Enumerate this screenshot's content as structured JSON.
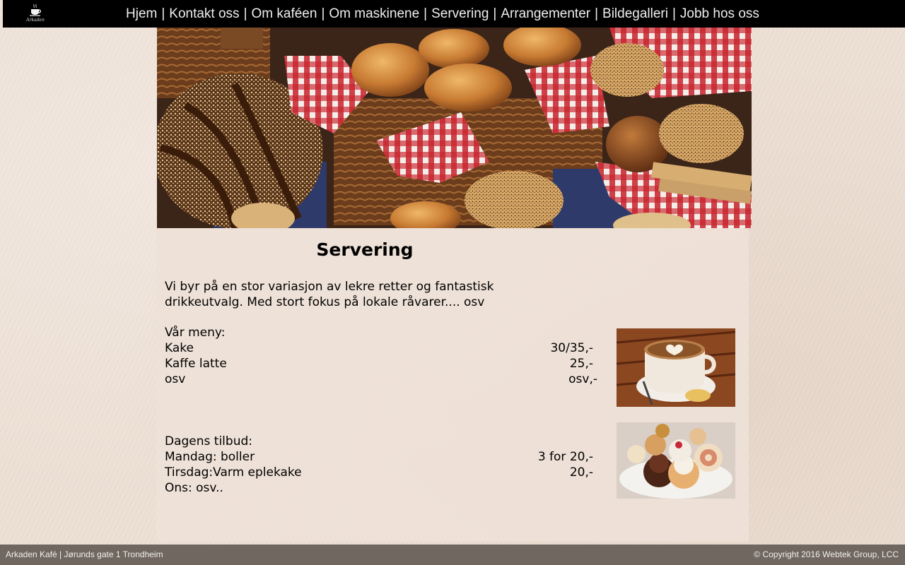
{
  "logo": {
    "name": "Arkaden",
    "icon": "coffee-cup-icon"
  },
  "nav": {
    "items": [
      {
        "label": "Hjem"
      },
      {
        "label": "Kontakt oss"
      },
      {
        "label": "Om kaféen"
      },
      {
        "label": "Om maskinene"
      },
      {
        "label": "Servering"
      },
      {
        "label": "Arrangementer"
      },
      {
        "label": "Bildegalleri"
      },
      {
        "label": "Jobb hos oss"
      }
    ],
    "separator": "|"
  },
  "page": {
    "title": "Servering",
    "intro": "Vi byr på en stor variasjon av lekre retter og fantastisk drikkeutvalg. Med stort fokus på lokale råvarer.... osv"
  },
  "menu": {
    "heading": "Vår meny:",
    "items": [
      {
        "name": "Kake",
        "price": "30/35,-"
      },
      {
        "name": "Kaffe latte",
        "price": "25,-"
      },
      {
        "name": "osv",
        "price": "osv,-"
      }
    ]
  },
  "offers": {
    "heading": "Dagens tilbud:",
    "items": [
      {
        "name": "Mandag: boller",
        "price": "3 for 20,-"
      },
      {
        "name": "Tirsdag:Varm eplekake",
        "price": "20,-"
      },
      {
        "name": "Ons: osv..",
        "price": ""
      }
    ]
  },
  "footer": {
    "left": "Arkaden Kafé | Jørunds gate 1 Trondheim",
    "right": "© Copyright 2016 Webtek Group, LCC"
  },
  "colors": {
    "topbar": "#000000",
    "nav_text": "#eeeeee",
    "footer_bg": "#706860",
    "page_bg": "#ecdfd4"
  }
}
